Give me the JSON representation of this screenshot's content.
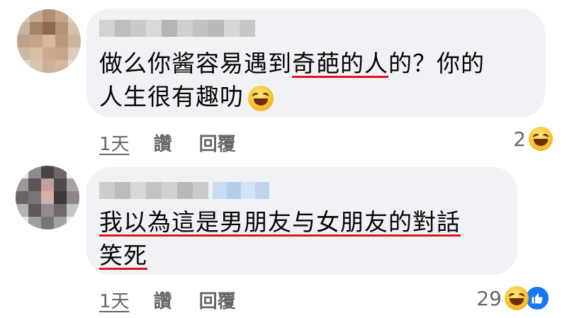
{
  "comments": [
    {
      "text_lines": [
        [
          "做么你酱容易遇到",
          "奇葩的人",
          "的？你的"
        ],
        [
          "人生很有趣叻"
        ]
      ],
      "inline_emoji": "laughing-emoji",
      "time": "1天",
      "like_label": "讚",
      "reply_label": "回覆",
      "reaction_count": "2",
      "reactions": [
        "haha"
      ]
    },
    {
      "text_lines": [
        [
          "我以為這是男朋友与女朋友的對話"
        ],
        [
          "笑死"
        ]
      ],
      "time": "1天",
      "like_label": "讚",
      "reply_label": "回覆",
      "reaction_count": "29",
      "reactions": [
        "haha",
        "like"
      ]
    }
  ],
  "colors": {
    "bubble": "#f0f2f5",
    "underline": "#e0141e",
    "meta_text": "#65676b",
    "like_blue": "#1877f2"
  }
}
